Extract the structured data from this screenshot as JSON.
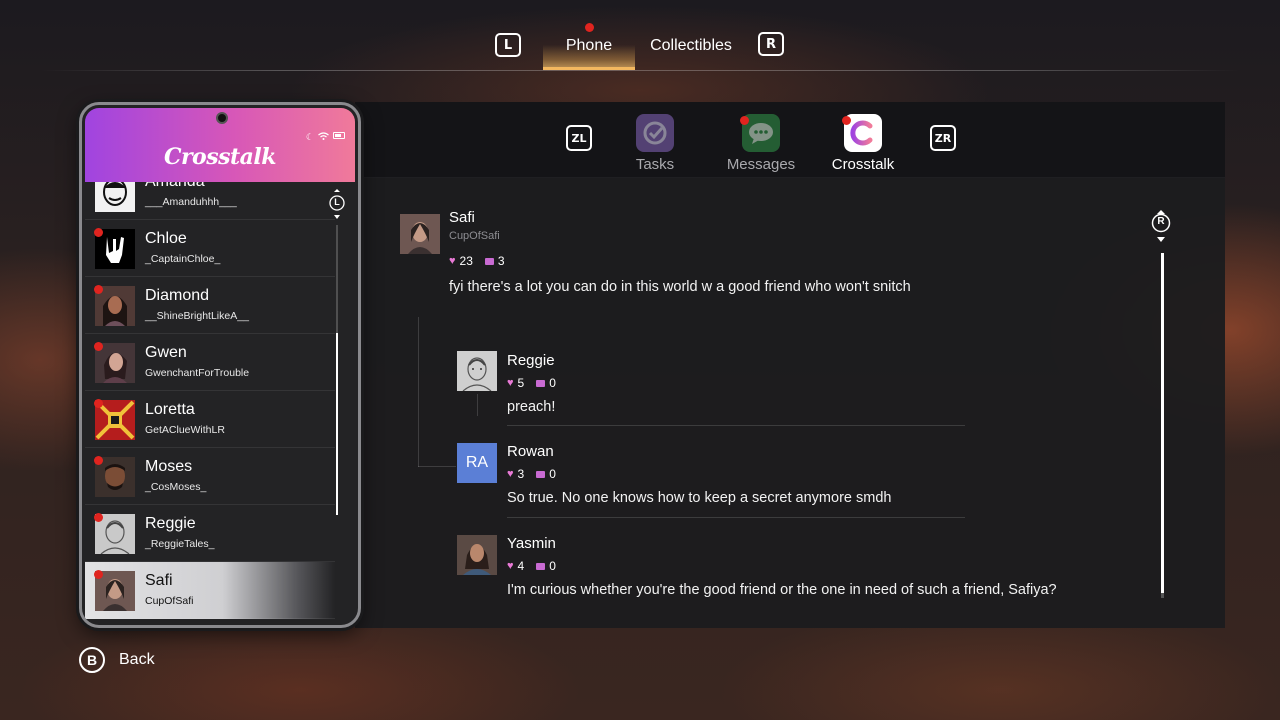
{
  "topnav": {
    "left_key": "L",
    "right_key": "R",
    "tabs": [
      {
        "label": "Phone",
        "active": true,
        "notification": true
      },
      {
        "label": "Collectibles",
        "active": false,
        "notification": false
      }
    ]
  },
  "apps": {
    "left_key": "ZL",
    "right_key": "ZR",
    "items": [
      {
        "label": "Tasks",
        "icon": "checkmark-icon",
        "color": "#7d5fb0",
        "active": false,
        "notification": false
      },
      {
        "label": "Messages",
        "icon": "chat-bubble-icon",
        "color": "#2f8f47",
        "active": false,
        "notification": true
      },
      {
        "label": "Crosstalk",
        "icon": "crosstalk-c-icon",
        "color": "#ffffff",
        "active": true,
        "notification": true
      }
    ]
  },
  "phone": {
    "app_title": "Crosstalk",
    "scroll_key": "L",
    "contacts": [
      {
        "name": "Amanda",
        "handle": "___Amanduhhh___",
        "notification": false,
        "active": false
      },
      {
        "name": "Chloe",
        "handle": "_CaptainChloe_",
        "notification": true,
        "active": false
      },
      {
        "name": "Diamond",
        "handle": "__ShineBrightLikeA__",
        "notification": true,
        "active": false
      },
      {
        "name": "Gwen",
        "handle": "GwenchantForTrouble",
        "notification": true,
        "active": false
      },
      {
        "name": "Loretta",
        "handle": "GetAClueWithLR",
        "notification": true,
        "active": false
      },
      {
        "name": "Moses",
        "handle": "_CosMoses_",
        "notification": true,
        "active": false
      },
      {
        "name": "Reggie",
        "handle": "_ReggieTales_",
        "notification": true,
        "active": false
      },
      {
        "name": "Safi",
        "handle": "CupOfSafi",
        "notification": true,
        "active": true
      }
    ]
  },
  "post": {
    "author": "Safi",
    "handle": "CupOfSafi",
    "likes": "23",
    "comments": "3",
    "text": "fyi there's a lot you can do in this world w a good friend who won't snitch",
    "scroll_key": "R",
    "replies": [
      {
        "author": "Reggie",
        "likes": "5",
        "comments": "0",
        "text": "preach!",
        "avatar_initials": ""
      },
      {
        "author": "Rowan",
        "likes": "3",
        "comments": "0",
        "text": "So true. No one knows how to keep a secret anymore smdh",
        "avatar_initials": "RA"
      },
      {
        "author": "Yasmin",
        "likes": "4",
        "comments": "0",
        "text": "I'm curious whether you're the good friend or the one in need of such a friend, Safiya?",
        "avatar_initials": ""
      }
    ]
  },
  "footer": {
    "back_key": "B",
    "back_label": "Back"
  }
}
